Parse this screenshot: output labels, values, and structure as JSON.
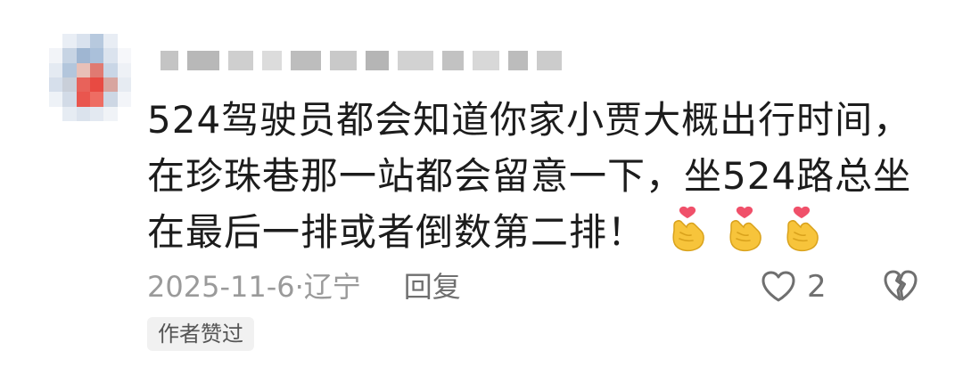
{
  "comment": {
    "text": "524驾驶员都会知道你家小贾大概出行时间，在珍珠巷那一站都会留意一下，坐524路总坐在最后一排或者倒数第二排！",
    "emoji_icons": [
      "heart-hands-emoji",
      "heart-hands-emoji",
      "heart-hands-emoji"
    ],
    "date": "2025-11-6",
    "location_separator": "·",
    "location": "辽宁",
    "reply_label": "回复",
    "like_count": "2",
    "author_badge": "作者赞过"
  },
  "colors": {
    "text": "#1c1c1c",
    "meta": "#9a9a9a",
    "icon": "#6f6f6f",
    "badge_bg": "#f1f1f1"
  }
}
